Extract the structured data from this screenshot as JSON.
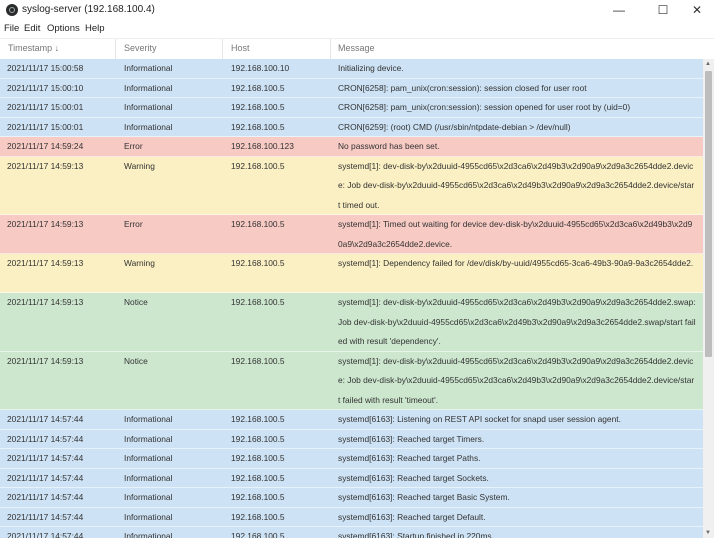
{
  "window": {
    "title": "syslog-server (192.168.100.4)",
    "minimize_glyph": "—",
    "maximize_glyph": "☐",
    "close_glyph": "✕"
  },
  "menu": [
    "File",
    "Edit",
    "Options",
    "Help"
  ],
  "columns": [
    "Timestamp ↓",
    "Severity",
    "Host",
    "Message"
  ],
  "colors": {
    "informational": "#cde2f4",
    "error": "#f7cac3",
    "warning": "#fbf0c3",
    "notice": "#cde7cf"
  },
  "rows": [
    {
      "timestamp": "2021/11/17 15:00:58",
      "severity": "Informational",
      "host": "192.168.100.10",
      "message": "Initializing device."
    },
    {
      "timestamp": "2021/11/17 15:00:10",
      "severity": "Informational",
      "host": "192.168.100.5",
      "message": "CRON[6258]: pam_unix(cron:session): session closed for user root"
    },
    {
      "timestamp": "2021/11/17 15:00:01",
      "severity": "Informational",
      "host": "192.168.100.5",
      "message": "CRON[6258]: pam_unix(cron:session): session opened for user root by (uid=0)"
    },
    {
      "timestamp": "2021/11/17 15:00:01",
      "severity": "Informational",
      "host": "192.168.100.5",
      "message": "CRON[6259]: (root) CMD (/usr/sbin/ntpdate-debian > /dev/null)"
    },
    {
      "timestamp": "2021/11/17 14:59:24",
      "severity": "Error",
      "host": "192.168.100.123",
      "message": "No password has been set."
    },
    {
      "timestamp": "2021/11/17 14:59:13",
      "severity": "Warning",
      "host": "192.168.100.5",
      "message": "systemd[1]: dev-disk-by\\x2duuid-4955cd65\\x2d3ca6\\x2d49b3\\x2d90a9\\x2d9a3c2654dde2.device: Job dev-disk-by\\x2duuid-4955cd65\\x2d3ca6\\x2d49b3\\x2d90a9\\x2d9a3c2654dde2.device/start timed out."
    },
    {
      "timestamp": "2021/11/17 14:59:13",
      "severity": "Error",
      "host": "192.168.100.5",
      "message": "systemd[1]: Timed out waiting for device dev-disk-by\\x2duuid-4955cd65\\x2d3ca6\\x2d49b3\\x2d90a9\\x2d9a3c2654dde2.device."
    },
    {
      "timestamp": "2021/11/17 14:59:13",
      "severity": "Warning",
      "host": "192.168.100.5",
      "message": "systemd[1]: Dependency failed for /dev/disk/by-uuid/4955cd65-3ca6-49b3-90a9-9a3c2654dde2."
    },
    {
      "timestamp": "2021/11/17 14:59:13",
      "severity": "Notice",
      "host": "192.168.100.5",
      "message": "systemd[1]: dev-disk-by\\x2duuid-4955cd65\\x2d3ca6\\x2d49b3\\x2d90a9\\x2d9a3c2654dde2.swap: Job dev-disk-by\\x2duuid-4955cd65\\x2d3ca6\\x2d49b3\\x2d90a9\\x2d9a3c2654dde2.swap/start failed with result 'dependency'."
    },
    {
      "timestamp": "2021/11/17 14:59:13",
      "severity": "Notice",
      "host": "192.168.100.5",
      "message": "systemd[1]: dev-disk-by\\x2duuid-4955cd65\\x2d3ca6\\x2d49b3\\x2d90a9\\x2d9a3c2654dde2.device: Job dev-disk-by\\x2duuid-4955cd65\\x2d3ca6\\x2d49b3\\x2d90a9\\x2d9a3c2654dde2.device/start failed with result 'timeout'."
    },
    {
      "timestamp": "2021/11/17 14:57:44",
      "severity": "Informational",
      "host": "192.168.100.5",
      "message": "systemd[6163]: Listening on REST API socket for snapd user session agent."
    },
    {
      "timestamp": "2021/11/17 14:57:44",
      "severity": "Informational",
      "host": "192.168.100.5",
      "message": "systemd[6163]: Reached target Timers."
    },
    {
      "timestamp": "2021/11/17 14:57:44",
      "severity": "Informational",
      "host": "192.168.100.5",
      "message": "systemd[6163]: Reached target Paths."
    },
    {
      "timestamp": "2021/11/17 14:57:44",
      "severity": "Informational",
      "host": "192.168.100.5",
      "message": "systemd[6163]: Reached target Sockets."
    },
    {
      "timestamp": "2021/11/17 14:57:44",
      "severity": "Informational",
      "host": "192.168.100.5",
      "message": "systemd[6163]: Reached target Basic System."
    },
    {
      "timestamp": "2021/11/17 14:57:44",
      "severity": "Informational",
      "host": "192.168.100.5",
      "message": "systemd[6163]: Reached target Default."
    },
    {
      "timestamp": "2021/11/17 14:57:44",
      "severity": "Informational",
      "host": "192.168.100.5",
      "message": "systemd[6163]: Startup finished in 220ms."
    }
  ],
  "scrollbar": {
    "up_glyph": "▲",
    "down_glyph": "▼"
  }
}
